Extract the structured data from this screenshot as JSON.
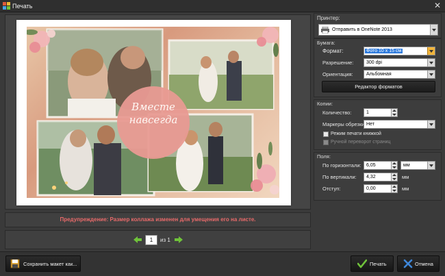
{
  "window": {
    "title": "Печать"
  },
  "preview": {
    "collage_caption_line1": "Вместе",
    "collage_caption_line2": "навсегда",
    "warning": "Предупреждение: Размер коллажа изменен для умещения его на листе."
  },
  "pager": {
    "current_page": "1",
    "of_label": "из 1"
  },
  "printer": {
    "group_label": "Принтер:",
    "selected": "Отправить в OneNote 2013"
  },
  "paper": {
    "group_label": "Бумага:",
    "format_label": "Формат:",
    "format_value": "Фото 10 x 15 см",
    "resolution_label": "Разрешение:",
    "resolution_value": "300 dpi",
    "orientation_label": "Ориентация:",
    "orientation_value": "Альбомная",
    "format_editor_button": "Редактор форматов"
  },
  "copies": {
    "group_label": "Копии:",
    "count_label": "Количество:",
    "count_value": "1",
    "crop_marks_label": "Маркеры обрезки:",
    "crop_marks_value": "Нет",
    "book_mode_label": "Режим печати книжкой",
    "manual_flip_label": "Ручной переворот страниц"
  },
  "margins": {
    "group_label": "Поля:",
    "horizontal_label": "По горизонтали:",
    "horizontal_value": "6,05",
    "unit_value": "мм",
    "vertical_label": "По вертикали:",
    "vertical_value": "4,32",
    "vertical_unit": "мм",
    "indent_label": "Отступ:",
    "indent_value": "0,00",
    "indent_unit": "мм"
  },
  "footer": {
    "save_layout_button": "Сохранить макет как...",
    "print_button": "Печать",
    "cancel_button": "Отмена"
  },
  "colors": {
    "accent_selection": "#2f7bdc",
    "warning_text": "#e86a6a",
    "focus_dropdown": "#f2b53c",
    "print_check": "#6fc23a",
    "cancel_x": "#3e86d8"
  },
  "icons": {
    "window": "app-icon",
    "close": "close-icon",
    "printer": "printer-icon",
    "prev_page": "arrow-left-icon",
    "next_page": "arrow-right-icon",
    "save": "save-icon",
    "print": "checkmark-icon",
    "cancel": "cross-icon"
  }
}
